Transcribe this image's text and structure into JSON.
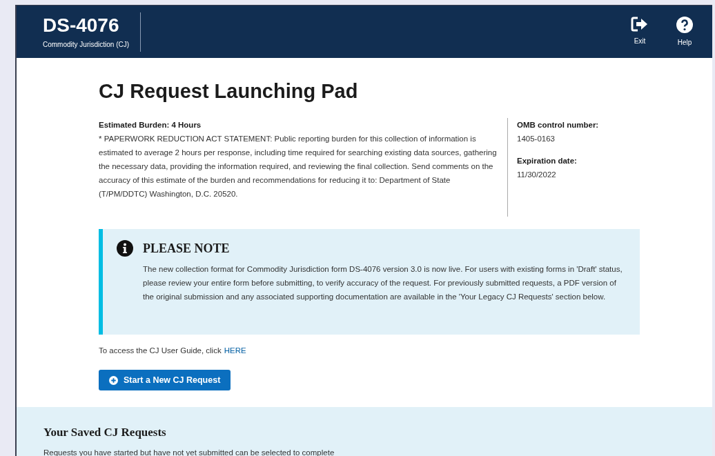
{
  "header": {
    "title": "DS-4076",
    "subtitle": "Commodity Jurisdiction (CJ)",
    "actions": [
      {
        "kind": "exit",
        "label": "Exit"
      },
      {
        "kind": "help",
        "label": "Help"
      }
    ]
  },
  "page_title": "CJ Request Launching Pad",
  "burden": {
    "heading": "Estimated Burden: 4 Hours",
    "statement": "* PAPERWORK REDUCTION ACT STATEMENT: Public reporting burden for this collection of information is estimated to average 2 hours per response, including time required for searching existing data sources, gathering the necessary data, providing the information required, and reviewing the final collection. Send comments on the accuracy of this estimate of the burden and recommendations for reducing it to: Department of State (T/PM/DDTC) Washington, D.C. 20520."
  },
  "omb": [
    {
      "label": "OMB control number:",
      "value": "1405-0163"
    },
    {
      "label": "Expiration date:",
      "value": "11/30/2022"
    }
  ],
  "note": {
    "title": "PLEASE NOTE",
    "text": "The new collection format for Commodity Jurisdiction form DS-4076 version 3.0 is now live. For users with existing forms in 'Draft' status, please review your entire form before submitting, to verify accuracy of the request. For previously submitted requests, a PDF version of the original submission and any associated supporting documentation are available in the 'Your Legacy CJ Requests' section below."
  },
  "guide": {
    "text": "To access the CJ User Guide, click",
    "link": "HERE"
  },
  "start_button": "Start a New CJ Request",
  "saved": {
    "title": "Your Saved CJ Requests",
    "description": "Requests you have started but have not yet submitted can be selected to complete"
  }
}
